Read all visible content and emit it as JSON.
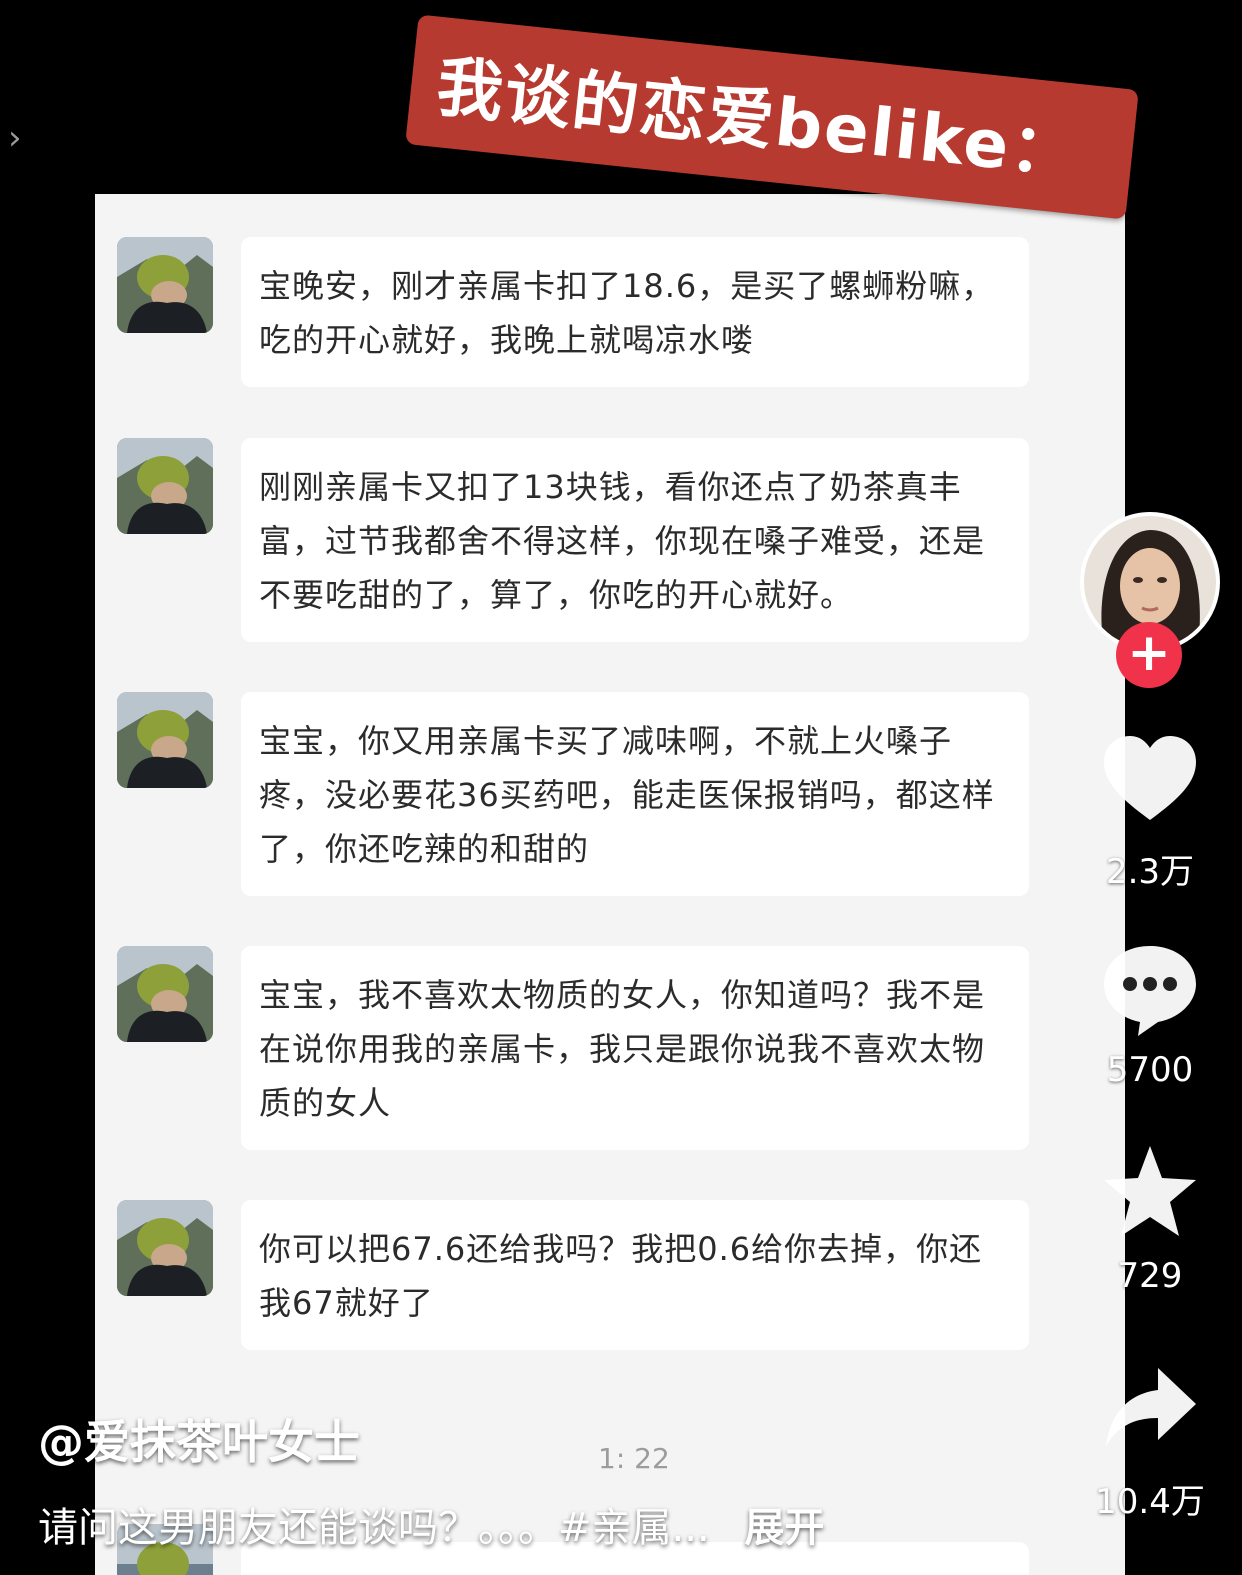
{
  "banner": {
    "title": "我谈的恋爱belike："
  },
  "messages": [
    {
      "text": "宝晚安，刚才亲属卡扣了18.6，是买了螺蛳粉嘛，吃的开心就好，我晚上就喝凉水喽"
    },
    {
      "text": "刚刚亲属卡又扣了13块钱，看你还点了奶茶真丰富，过节我都舍不得这样，你现在嗓子难受，还是不要吃甜的了，算了，你吃的开心就好。"
    },
    {
      "text": "宝宝，你又用亲属卡买了减味啊，不就上火嗓子疼，没必要花36买药吧，能走医保报销吗，都这样了，你还吃辣的和甜的"
    },
    {
      "text": "宝宝，我不喜欢太物质的女人，你知道吗？我不是在说你用我的亲属卡，我只是跟你说我不喜欢太物质的女人"
    },
    {
      "text": "你可以把67.6还给我吗？我把0.6给你去掉，你还我67就好了"
    }
  ],
  "chat_time": "1:  22",
  "side_actions": {
    "likes": "2.3万",
    "comments": "5700",
    "favorites": "729",
    "shares": "10.4万"
  },
  "author": "@爱抹茶叶女士",
  "caption": {
    "text": "请问这男朋友还能谈吗？。。。#亲属...",
    "expand_label": "展开"
  },
  "colors": {
    "banner_red": "#b73a30",
    "follow_red": "#f0334a",
    "chat_bg": "#f4f4f4"
  }
}
